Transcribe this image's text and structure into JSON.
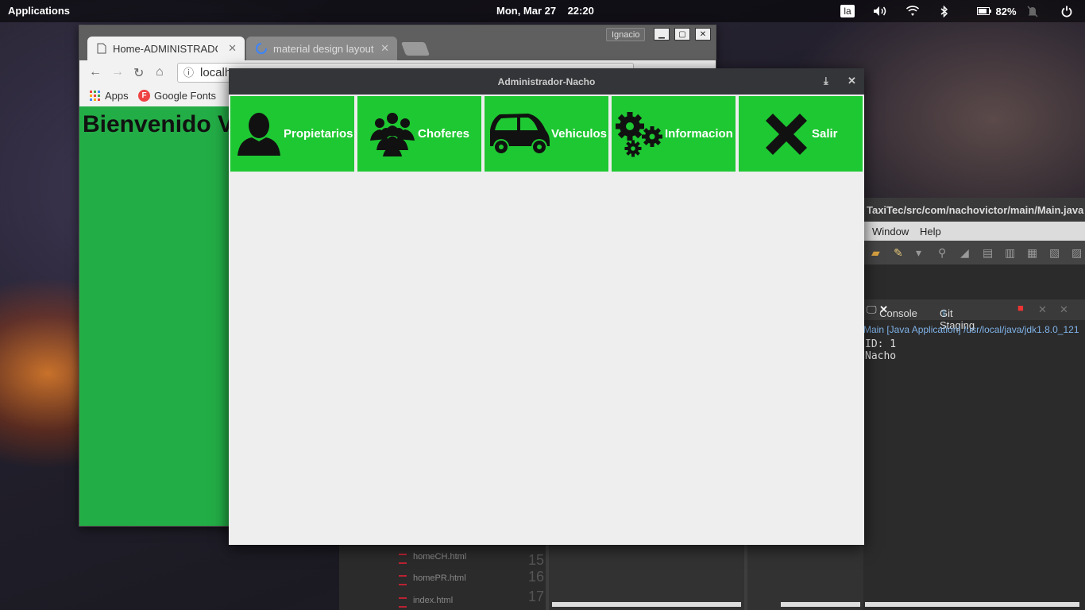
{
  "topbar": {
    "applications": "Applications",
    "clock": "Mon, Mar 27    22:20",
    "keyboard": "la",
    "battery": "82%"
  },
  "browser": {
    "tabs": [
      "Home-ADMINISTRADOR",
      "material design layout"
    ],
    "user": "Ignacio",
    "url": "localh",
    "bookmarks": [
      "Apps",
      "Google Fonts"
    ],
    "page_heading": "Bienvenido V"
  },
  "eclipse": {
    "title": "TaxiTec/src/com/nachovictor/main/Main.java -",
    "menu": [
      "Window",
      "Help"
    ],
    "tabs": [
      "Console",
      "Git Staging"
    ],
    "console_header": "Main [Java Application] /usr/local/java/jdk1.8.0_121",
    "console_lines": [
      "ID: 1",
      "Nacho"
    ],
    "files": [
      "homeCH.html",
      "homePR.html",
      "index.html"
    ],
    "line_numbers": [
      "15",
      "16",
      "17"
    ]
  },
  "app": {
    "title": "Administrador-Nacho",
    "accent": "#1ec832",
    "buttons": [
      {
        "label": "Propietarios",
        "icon": "user-icon"
      },
      {
        "label": "Choferes",
        "icon": "group-icon"
      },
      {
        "label": "Vehiculos",
        "icon": "car-icon"
      },
      {
        "label": "Informacion",
        "icon": "gears-icon"
      },
      {
        "label": "Salir",
        "icon": "close-x-icon"
      }
    ]
  }
}
